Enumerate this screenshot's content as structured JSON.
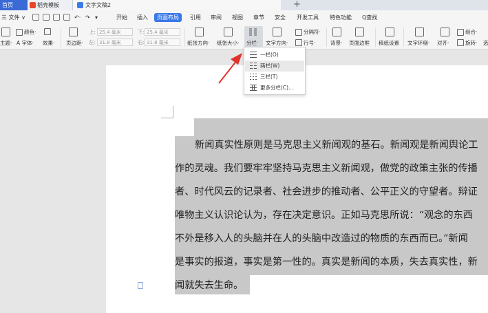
{
  "tabs": {
    "home": "首页",
    "template": "稻壳模板",
    "document": "文字文稿2",
    "new_tab": "+"
  },
  "menu": {
    "file": "三 文件 ∨",
    "items": [
      "开始",
      "插入",
      "页面布局",
      "引用",
      "审阅",
      "视图",
      "章节",
      "安全",
      "开发工具",
      "特色功能"
    ],
    "search": "Q查找"
  },
  "ribbon": {
    "theme": "主题·",
    "colors": "颜色·",
    "fonts": "A 字体·",
    "effects": "效果·",
    "margins": "页边距·",
    "margin_top_label": "上:",
    "margin_top": "25.4 毫米",
    "margin_bottom_label": "下:",
    "margin_bottom": "25.4 毫米",
    "margin_left_label": "左:",
    "margin_left": "31.8 毫米",
    "margin_right_label": "右:",
    "margin_right": "31.8 毫米",
    "orientation": "纸张方向·",
    "size": "纸张大小·",
    "columns": "分栏·",
    "text_direction": "文字方向·",
    "breaks": "分隔符·",
    "line_numbers": "行号·",
    "background": "背景·",
    "page_border": "页面边框",
    "draft_paper": "稿纸设置",
    "wrap": "文字环绕·",
    "align": "对齐·",
    "group": "组合·",
    "rotate": "旋转·",
    "select": "选"
  },
  "columns_menu": {
    "one": "一栏(O)",
    "two": "两栏(W)",
    "three": "三栏(T)",
    "more": "更多分栏(C)..."
  },
  "document": {
    "lines": [
      "新闻真实性原则是马克思主义新闻观的基石。新闻观是新闻舆论工",
      "作的灵魂。我们要牢牢坚持马克思主义新闻观，做党的政策主张的传播",
      "者、时代风云的记录者、社会进步的推动者、公平正义的守望者。辩证",
      "唯物主义认识论认为，存在决定意识。正如马克思所说：“观念的东西",
      "不外是移入人的头脑并在人的头脑中改造过的物质的东西而已。”新闻",
      "是事实的报道，事实是第一性的。真实是新闻的本质，失去真实性，新",
      "闻就失去生命。"
    ]
  },
  "colors": {
    "accent": "#3b78e7",
    "selection": "#c8c8c8",
    "arrow": "#e0322b"
  }
}
